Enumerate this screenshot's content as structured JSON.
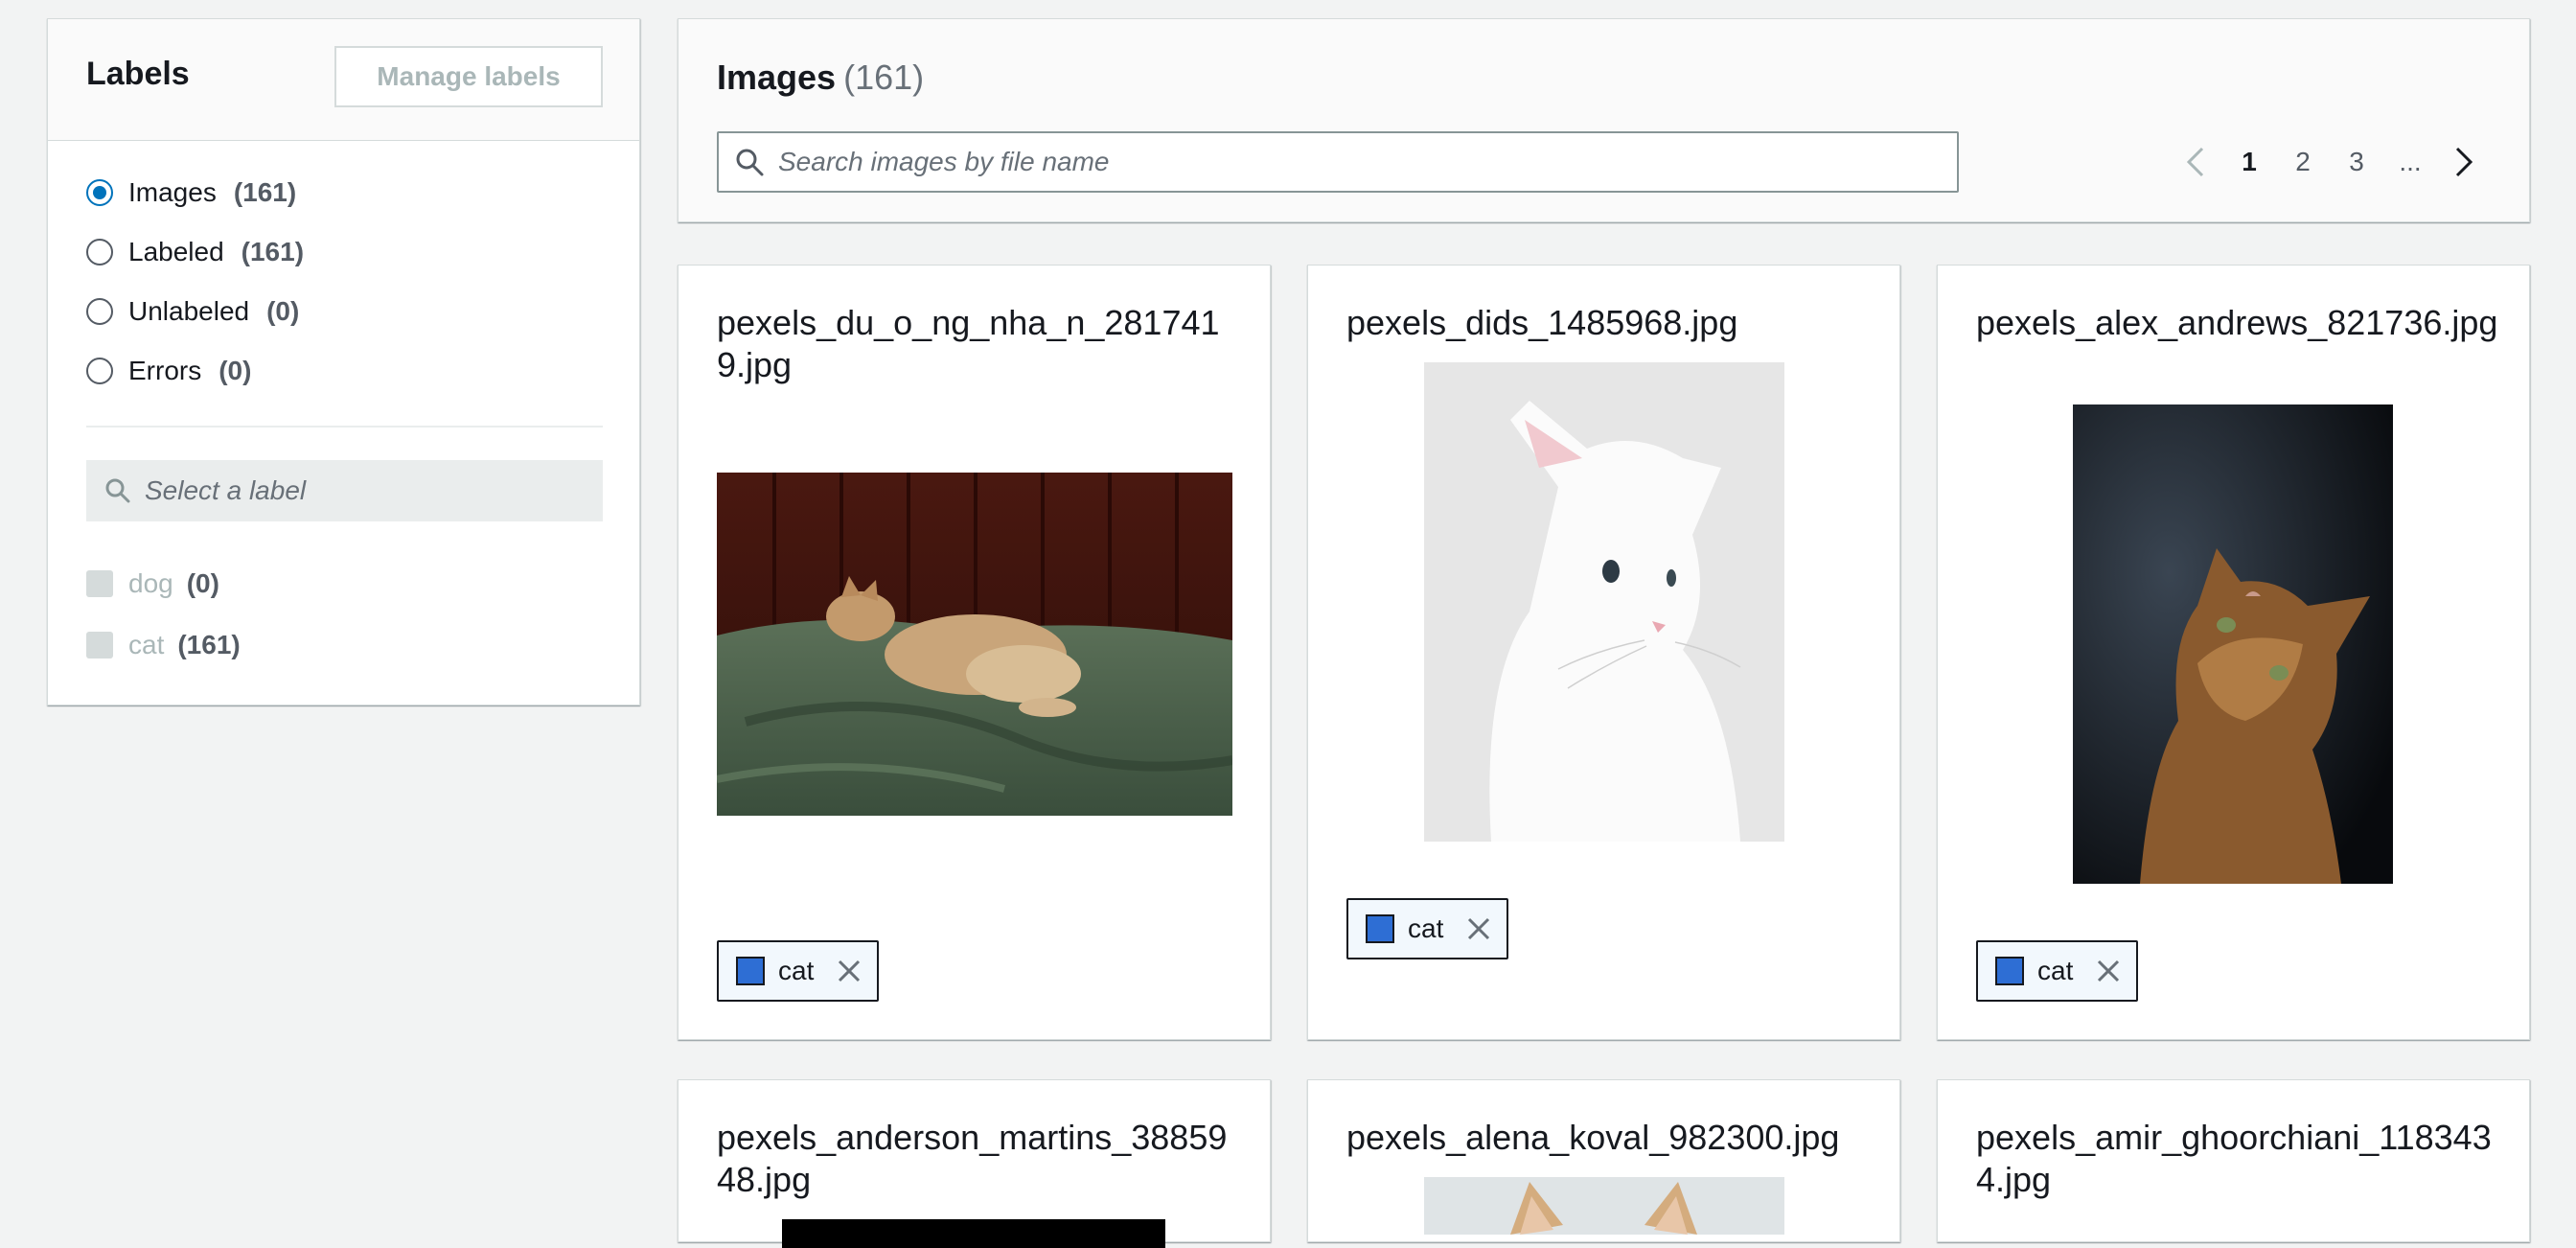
{
  "labels_panel": {
    "title": "Labels",
    "manage_button": "Manage labels",
    "filters": [
      {
        "label": "Images",
        "count": "(161)",
        "selected": true
      },
      {
        "label": "Labeled",
        "count": "(161)",
        "selected": false
      },
      {
        "label": "Unlabeled",
        "count": "(0)",
        "selected": false
      },
      {
        "label": "Errors",
        "count": "(0)",
        "selected": false
      }
    ],
    "label_search_placeholder": "Select a label",
    "labels": [
      {
        "name": "dog",
        "count": "(0)"
      },
      {
        "name": "cat",
        "count": "(161)"
      }
    ]
  },
  "images_panel": {
    "title": "Images",
    "count": "(161)",
    "search_placeholder": "Search images by file name",
    "pagination": {
      "pages": [
        "1",
        "2",
        "3",
        "..."
      ],
      "current": "1"
    }
  },
  "cards": [
    {
      "filename": "pexels_du_o_ng_nha_n_2817419.jpg",
      "tag": "cat"
    },
    {
      "filename": "pexels_dids_1485968.jpg",
      "tag": "cat"
    },
    {
      "filename": "pexels_alex_andrews_821736.jpg",
      "tag": "cat"
    },
    {
      "filename": "pexels_anderson_martins_3885948.jpg"
    },
    {
      "filename": "pexels_alena_koval_982300.jpg"
    },
    {
      "filename": "pexels_amir_ghoorchiani_1183434.jpg"
    }
  ],
  "colors": {
    "accent": "#0073bb",
    "tag_swatch": "#2e6ed4",
    "background": "#f2f3f3"
  }
}
